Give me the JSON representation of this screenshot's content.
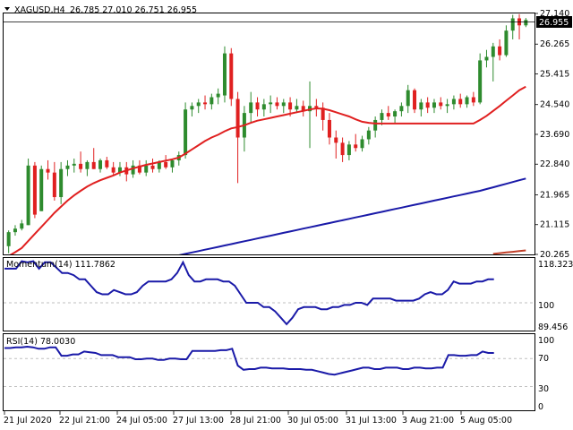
{
  "header": {
    "symbol": "XAGUSD,H4",
    "ohlc": "26.785 27.010 26.751 26.955"
  },
  "current_price": "26.955",
  "momentum": {
    "label": "Momentum(14) 111.7862",
    "current": "118.3238",
    "ticks": [
      "100",
      "89.456"
    ]
  },
  "rsi": {
    "label": "RSI(14) 78.0030",
    "ticks": [
      "100",
      "70",
      "30",
      "0"
    ]
  },
  "colors": {
    "bull": "#2e8b2e",
    "bear": "#e02020",
    "ma_fast": "#e02020",
    "ma_slow": "#1a1aa8",
    "ma_long": "#c0402a",
    "indicator": "#1a1aa8",
    "grid": "#bfbfbf",
    "frame": "#000000"
  },
  "chart_data": [
    {
      "type": "candlestick",
      "title": "XAGUSD,H4",
      "ylim": [
        20.265,
        27.14
      ],
      "y_ticks": [
        "27.140",
        "26.265",
        "25.415",
        "24.540",
        "23.690",
        "22.840",
        "21.965",
        "21.115",
        "20.265"
      ],
      "x_ticks": [
        "21 Jul 2020",
        "22 Jul 21:00",
        "24 Jul 05:00",
        "27 Jul 13:00",
        "28 Jul 21:00",
        "30 Jul 05:00",
        "31 Jul 13:00",
        "3 Aug 21:00",
        "5 Aug 05:00"
      ],
      "candles": [
        [
          20.5,
          20.95,
          20.3,
          20.9
        ],
        [
          20.9,
          21.1,
          20.8,
          21.0
        ],
        [
          21.0,
          21.25,
          20.95,
          21.15
        ],
        [
          21.1,
          23.0,
          21.1,
          22.8
        ],
        [
          22.8,
          22.9,
          21.3,
          21.4
        ],
        [
          21.5,
          22.8,
          21.5,
          22.7
        ],
        [
          22.7,
          22.95,
          22.4,
          22.6
        ],
        [
          22.6,
          22.9,
          21.8,
          21.9
        ],
        [
          21.9,
          22.9,
          21.7,
          22.7
        ],
        [
          22.7,
          22.95,
          22.5,
          22.8
        ],
        [
          22.8,
          23.0,
          22.6,
          22.85
        ],
        [
          22.85,
          23.2,
          22.6,
          22.7
        ],
        [
          22.7,
          22.95,
          22.5,
          22.9
        ],
        [
          22.9,
          23.3,
          22.7,
          22.7
        ],
        [
          22.7,
          23.0,
          22.6,
          22.95
        ],
        [
          22.95,
          23.05,
          22.7,
          22.75
        ],
        [
          22.75,
          22.9,
          22.5,
          22.6
        ],
        [
          22.6,
          22.9,
          22.5,
          22.75
        ],
        [
          22.75,
          22.9,
          22.35,
          22.55
        ],
        [
          22.55,
          22.95,
          22.45,
          22.8
        ],
        [
          22.8,
          22.95,
          22.55,
          22.6
        ],
        [
          22.6,
          22.95,
          22.5,
          22.8
        ],
        [
          22.8,
          23.0,
          22.6,
          22.7
        ],
        [
          22.7,
          22.95,
          22.6,
          22.9
        ],
        [
          22.9,
          23.1,
          22.7,
          22.75
        ],
        [
          22.75,
          23.0,
          22.6,
          22.95
        ],
        [
          22.95,
          23.2,
          22.8,
          23.1
        ],
        [
          23.1,
          24.6,
          23.0,
          24.4
        ],
        [
          24.4,
          24.6,
          24.2,
          24.5
        ],
        [
          24.5,
          24.7,
          24.3,
          24.6
        ],
        [
          24.6,
          24.8,
          24.4,
          24.55
        ],
        [
          24.55,
          24.85,
          24.4,
          24.75
        ],
        [
          24.75,
          25.0,
          24.55,
          24.85
        ],
        [
          24.8,
          26.2,
          24.6,
          26.0
        ],
        [
          26.0,
          26.15,
          24.5,
          24.7
        ],
        [
          24.7,
          24.9,
          22.3,
          23.6
        ],
        [
          23.6,
          24.5,
          23.2,
          24.3
        ],
        [
          24.3,
          24.9,
          24.0,
          24.6
        ],
        [
          24.6,
          24.75,
          24.2,
          24.4
        ],
        [
          24.4,
          24.7,
          24.2,
          24.55
        ],
        [
          24.55,
          24.8,
          24.3,
          24.6
        ],
        [
          24.6,
          24.75,
          24.4,
          24.5
        ],
        [
          24.5,
          24.7,
          24.3,
          24.6
        ],
        [
          24.6,
          24.75,
          24.2,
          24.4
        ],
        [
          24.4,
          24.7,
          24.3,
          24.5
        ],
        [
          24.5,
          24.65,
          24.2,
          24.35
        ],
        [
          24.35,
          25.2,
          23.3,
          24.5
        ],
        [
          24.5,
          24.7,
          24.2,
          24.45
        ],
        [
          24.45,
          24.6,
          23.8,
          24.1
        ],
        [
          24.1,
          24.3,
          23.4,
          23.6
        ],
        [
          23.6,
          23.8,
          23.0,
          23.45
        ],
        [
          23.45,
          23.6,
          22.9,
          23.1
        ],
        [
          23.1,
          23.5,
          22.95,
          23.4
        ],
        [
          23.4,
          23.7,
          23.2,
          23.3
        ],
        [
          23.3,
          23.65,
          23.2,
          23.55
        ],
        [
          23.55,
          23.9,
          23.4,
          23.8
        ],
        [
          23.8,
          24.2,
          23.6,
          24.1
        ],
        [
          24.1,
          24.4,
          23.95,
          24.3
        ],
        [
          24.3,
          24.5,
          24.1,
          24.2
        ],
        [
          24.2,
          24.4,
          24.0,
          24.35
        ],
        [
          24.35,
          24.6,
          24.2,
          24.5
        ],
        [
          24.5,
          25.1,
          24.3,
          24.95
        ],
        [
          24.95,
          25.0,
          24.3,
          24.4
        ],
        [
          24.4,
          24.7,
          24.2,
          24.6
        ],
        [
          24.6,
          24.75,
          24.3,
          24.45
        ],
        [
          24.45,
          24.7,
          24.3,
          24.6
        ],
        [
          24.6,
          24.75,
          24.4,
          24.5
        ],
        [
          24.5,
          24.7,
          24.3,
          24.55
        ],
        [
          24.55,
          24.8,
          24.4,
          24.7
        ],
        [
          24.7,
          24.85,
          24.45,
          24.55
        ],
        [
          24.55,
          24.8,
          24.45,
          24.75
        ],
        [
          24.75,
          24.9,
          24.5,
          24.6
        ],
        [
          24.6,
          26.0,
          24.55,
          25.8
        ],
        [
          25.8,
          26.1,
          25.6,
          25.9
        ],
        [
          25.9,
          26.3,
          25.2,
          26.2
        ],
        [
          26.2,
          26.4,
          25.8,
          25.95
        ],
        [
          25.95,
          26.8,
          25.9,
          26.65
        ],
        [
          26.65,
          27.1,
          26.4,
          27.0
        ],
        [
          27.0,
          27.12,
          26.4,
          26.8
        ],
        [
          26.8,
          27.01,
          26.75,
          26.955
        ]
      ],
      "series": [
        {
          "name": "",
          "values": [
            20.22,
            20.33,
            20.45,
            20.65,
            20.85,
            21.05,
            21.25,
            21.45,
            21.63,
            21.8,
            21.95,
            22.08,
            22.2,
            22.3,
            22.38,
            22.45,
            22.52,
            22.6,
            22.66,
            22.72,
            22.77,
            22.82,
            22.86,
            22.9,
            22.94,
            22.98,
            23.03,
            23.14,
            23.26,
            23.38,
            23.5,
            23.6,
            23.68,
            23.78,
            23.86,
            23.9,
            23.95,
            24.02,
            24.08,
            24.12,
            24.16,
            24.2,
            24.24,
            24.28,
            24.32,
            24.36,
            24.4,
            24.43,
            24.42,
            24.38,
            24.32,
            24.26,
            24.2,
            24.12,
            24.05,
            24.02,
            24.0,
            24.0,
            24.0,
            24.0,
            24.0,
            24.0,
            24.0,
            24.0,
            24.0,
            24.0,
            24.0,
            24.0,
            24.0,
            24.0,
            24.0,
            24.0,
            24.1,
            24.22,
            24.36,
            24.5,
            24.65,
            24.8,
            24.95,
            25.05
          ]
        },
        {
          "name": "",
          "values": [
            19.2,
            19.24,
            19.28,
            19.32,
            19.36,
            19.4,
            19.44,
            19.48,
            19.52,
            19.56,
            19.6,
            19.64,
            19.68,
            19.72,
            19.76,
            19.8,
            19.84,
            19.88,
            19.92,
            19.96,
            20.0,
            20.04,
            20.08,
            20.12,
            20.16,
            20.2,
            20.24,
            20.28,
            20.32,
            20.36,
            20.4,
            20.44,
            20.48,
            20.52,
            20.56,
            20.6,
            20.64,
            20.68,
            20.72,
            20.76,
            20.8,
            20.84,
            20.88,
            20.92,
            20.96,
            21.0,
            21.04,
            21.08,
            21.12,
            21.16,
            21.2,
            21.24,
            21.28,
            21.32,
            21.36,
            21.4,
            21.44,
            21.48,
            21.52,
            21.56,
            21.6,
            21.64,
            21.68,
            21.72,
            21.76,
            21.8,
            21.84,
            21.88,
            21.92,
            21.96,
            22.0,
            22.04,
            22.08,
            22.13,
            22.18,
            22.23,
            22.28,
            22.33,
            22.38,
            22.43
          ]
        },
        {
          "name": "",
          "values": [
            20.28,
            20.3,
            20.32,
            20.34,
            20.36,
            20.38
          ]
        }
      ]
    },
    {
      "type": "line",
      "title": "Momentum(14)",
      "ylim": [
        87.0,
        121.0
      ],
      "series": [
        {
          "name": "",
          "values": [
            116,
            116,
            116,
            119.5,
            119,
            119.5,
            116,
            119,
            119,
            116.5,
            114,
            114,
            113,
            111,
            111,
            108,
            105,
            104,
            104,
            106,
            105,
            104,
            104,
            105,
            108,
            110,
            110,
            110,
            110,
            111,
            114,
            119,
            113,
            110,
            110,
            111,
            111,
            111,
            110,
            110,
            108,
            104,
            100,
            100,
            100,
            98,
            98,
            96,
            93,
            90,
            93,
            97,
            98,
            98,
            98,
            97,
            97,
            98,
            98,
            99,
            99,
            100,
            100,
            99,
            102,
            102,
            102,
            102,
            101,
            101,
            101,
            101,
            102,
            104,
            105,
            104,
            104,
            106,
            110,
            109,
            109,
            109,
            110,
            110,
            111,
            111
          ]
        }
      ]
    },
    {
      "type": "line",
      "title": "RSI(14)",
      "ylim": [
        0,
        100
      ],
      "series": [
        {
          "name": "",
          "values": [
            85,
            85,
            86,
            86,
            87,
            86,
            84,
            84,
            86,
            86,
            74,
            74,
            76,
            76,
            80,
            79,
            78,
            75,
            75,
            75,
            72,
            72,
            72,
            69,
            69,
            70,
            70,
            68,
            68,
            70,
            70,
            69,
            69,
            81,
            81,
            81,
            81,
            81,
            82,
            82,
            84,
            60,
            54,
            55,
            55,
            57,
            57,
            56,
            56,
            56,
            55,
            55,
            55,
            54,
            54,
            52,
            50,
            48,
            47,
            49,
            51,
            53,
            55,
            57,
            57,
            55,
            55,
            57,
            57,
            57,
            55,
            55,
            57,
            57,
            56,
            56,
            57,
            57,
            75,
            75,
            74,
            74,
            75,
            75,
            80,
            78,
            78
          ]
        }
      ]
    }
  ]
}
